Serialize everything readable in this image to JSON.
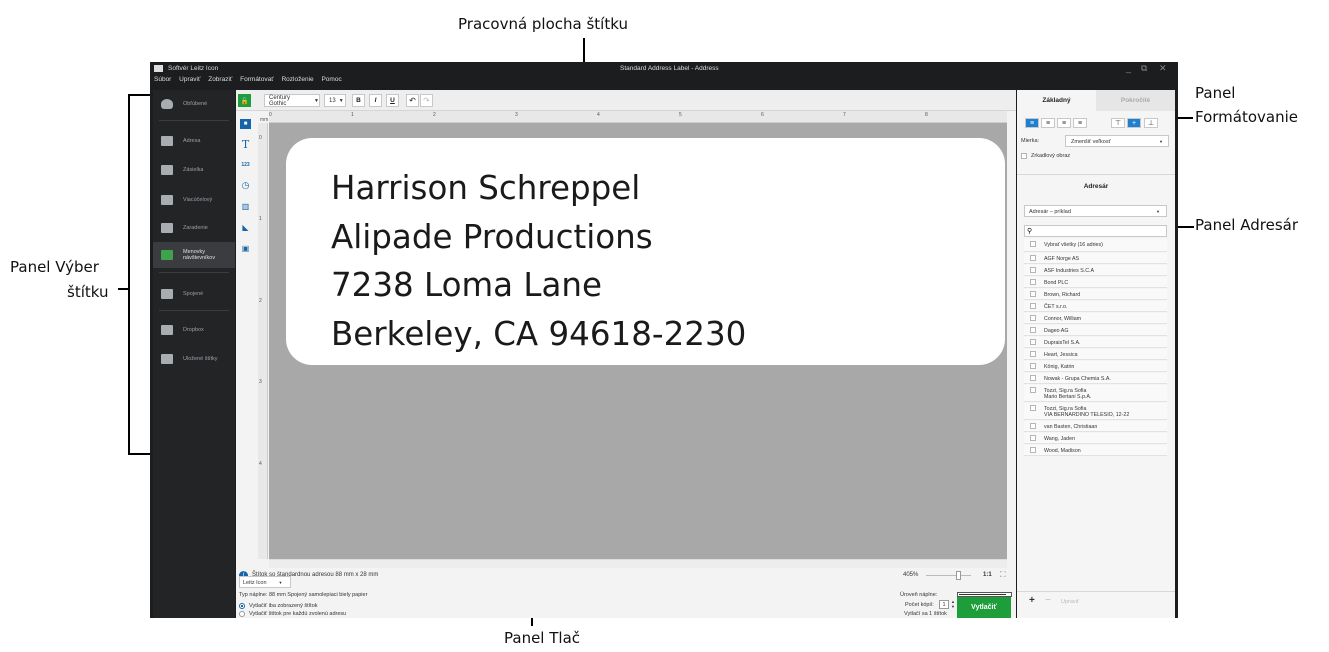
{
  "callouts": {
    "workspace": "Pracovná plocha štítku",
    "formatting": [
      "Panel",
      "Formátovanie"
    ],
    "address": "Panel Adresár",
    "select": [
      "Panel Výber",
      "štítku"
    ],
    "print": "Panel Tlač"
  },
  "window": {
    "app_title": "Softvér Leitz Icon",
    "doc_title": "Standard Address Label - Address",
    "controls": [
      "_",
      "⧉",
      "✕"
    ]
  },
  "menu": [
    "Súbor",
    "Upraviť",
    "Zobraziť",
    "Formátovať",
    "Rozloženie",
    "Pomoc"
  ],
  "sidebar": [
    {
      "label": "Obľúbené",
      "icon": "heart-icon"
    },
    {
      "label": "Adresa",
      "icon": "address-card-icon"
    },
    {
      "label": "Zásielka",
      "icon": "shipping-icon"
    },
    {
      "label": "Viacúčelový",
      "icon": "layers-icon"
    },
    {
      "label": "Zaradenie",
      "icon": "folder-icon"
    },
    {
      "label": "Menovky návštevníkov",
      "icon": "name-badge-icon"
    },
    {
      "label": "Spojené",
      "icon": "link-icon"
    },
    {
      "label": "Dropbox",
      "icon": "dropbox-icon"
    },
    {
      "label": "Uložené štítky",
      "icon": "saved-icon"
    }
  ],
  "toolbar": {
    "font": "Century Gothic",
    "size": "13",
    "bold": "B",
    "italic": "I",
    "underline": "U",
    "unit": "mm"
  },
  "ruler": {
    "top": [
      "0",
      "1",
      "2",
      "3",
      "4",
      "5",
      "6",
      "7",
      "8"
    ],
    "left": [
      "0",
      "1",
      "2",
      "3",
      "4"
    ]
  },
  "label": {
    "lines": [
      "Harrison Schreppel",
      "Alipade Productions",
      "7238 Loma Lane",
      "Berkeley, CA 94618-2230"
    ]
  },
  "status": {
    "info": "Štítok so štandardnou adresou 88 mm x 28 mm",
    "zoom": "405%",
    "zoom_fit": "1:1"
  },
  "print": {
    "printer": "Leitz Icon",
    "cartridge": "Typ náplne: 88 mm Spojený samolepiaci biely papier",
    "option1": "Vytlačiť iba zobrazený štítok",
    "option2": "Vytlačiť štítok pre každú zvolenú adresu",
    "level_label": "Úroveň náplne:",
    "copies_label": "Počet kópií:",
    "copies": "1",
    "prints_label": "Vytlačí sa 1 štítok",
    "print_button": "Vytlačiť"
  },
  "formatting": {
    "tab_basic": "Základný",
    "tab_advanced": "Pokročilé",
    "scale_label": "Mierka:",
    "scale_value": "Zmenšiť veľkosť",
    "mirror": "Zrkadlový obraz"
  },
  "addressbook": {
    "title": "Adresár",
    "selected": "Adresár – príklad",
    "select_all": "Vybrať všetky (16 adries)",
    "items": [
      "AGF Norge AS",
      "ASF Industries S.C.A",
      "Bond PLC",
      "Brown, Richard",
      "ČET s.r.o.",
      "Connor, William",
      "Dageo AG",
      "DupraisTel S.A.",
      "Heart, Jessica",
      "König, Katrin",
      "Nowak - Grupa Chemia S.A.",
      "Tozzi, Sig.ra Sofia\nMario Bertani S.p.A.",
      "Tozzi, Sig.ra Sofia\nVIA BERNARDINO TELESIO, 12-22",
      "van Basten, Christiaan",
      "Wang, Jaden",
      "Wood, Madison"
    ],
    "add": "+",
    "remove": "−",
    "edit": "Upraviť"
  },
  "colors": {
    "accent_green": "#1e9e3b",
    "accent_blue": "#1f7fd1",
    "sidebar": "#222426"
  }
}
